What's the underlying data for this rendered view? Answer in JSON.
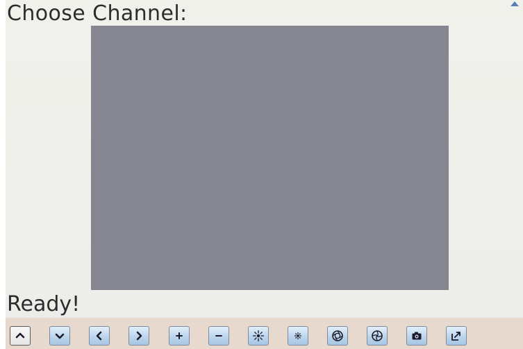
{
  "header": {
    "title": "Choose Channel:"
  },
  "status": {
    "text": "Ready!"
  },
  "toolbar": {
    "buttons": [
      {
        "name": "tilt-up",
        "icon": "chevron-up-icon"
      },
      {
        "name": "tilt-down",
        "icon": "chevron-down-icon"
      },
      {
        "name": "pan-left",
        "icon": "chevron-left-icon"
      },
      {
        "name": "pan-right",
        "icon": "chevron-right-icon"
      },
      {
        "name": "zoom-in",
        "icon": "plus-icon"
      },
      {
        "name": "zoom-out",
        "icon": "minus-icon"
      },
      {
        "name": "brightness-up",
        "icon": "sun-large-icon"
      },
      {
        "name": "brightness-down",
        "icon": "sun-small-icon"
      },
      {
        "name": "iris-open",
        "icon": "aperture-open-icon"
      },
      {
        "name": "iris-close",
        "icon": "aperture-closed-icon"
      },
      {
        "name": "snapshot",
        "icon": "camera-icon"
      },
      {
        "name": "fullscreen",
        "icon": "expand-icon"
      }
    ]
  },
  "colors": {
    "preview_background": "#85868f",
    "toolbar_background": "#e7d9cd",
    "button_gradient_top": "#e2effa",
    "button_gradient_bottom": "#a7c6e4",
    "accent_arrow": "#5b7fb5"
  }
}
